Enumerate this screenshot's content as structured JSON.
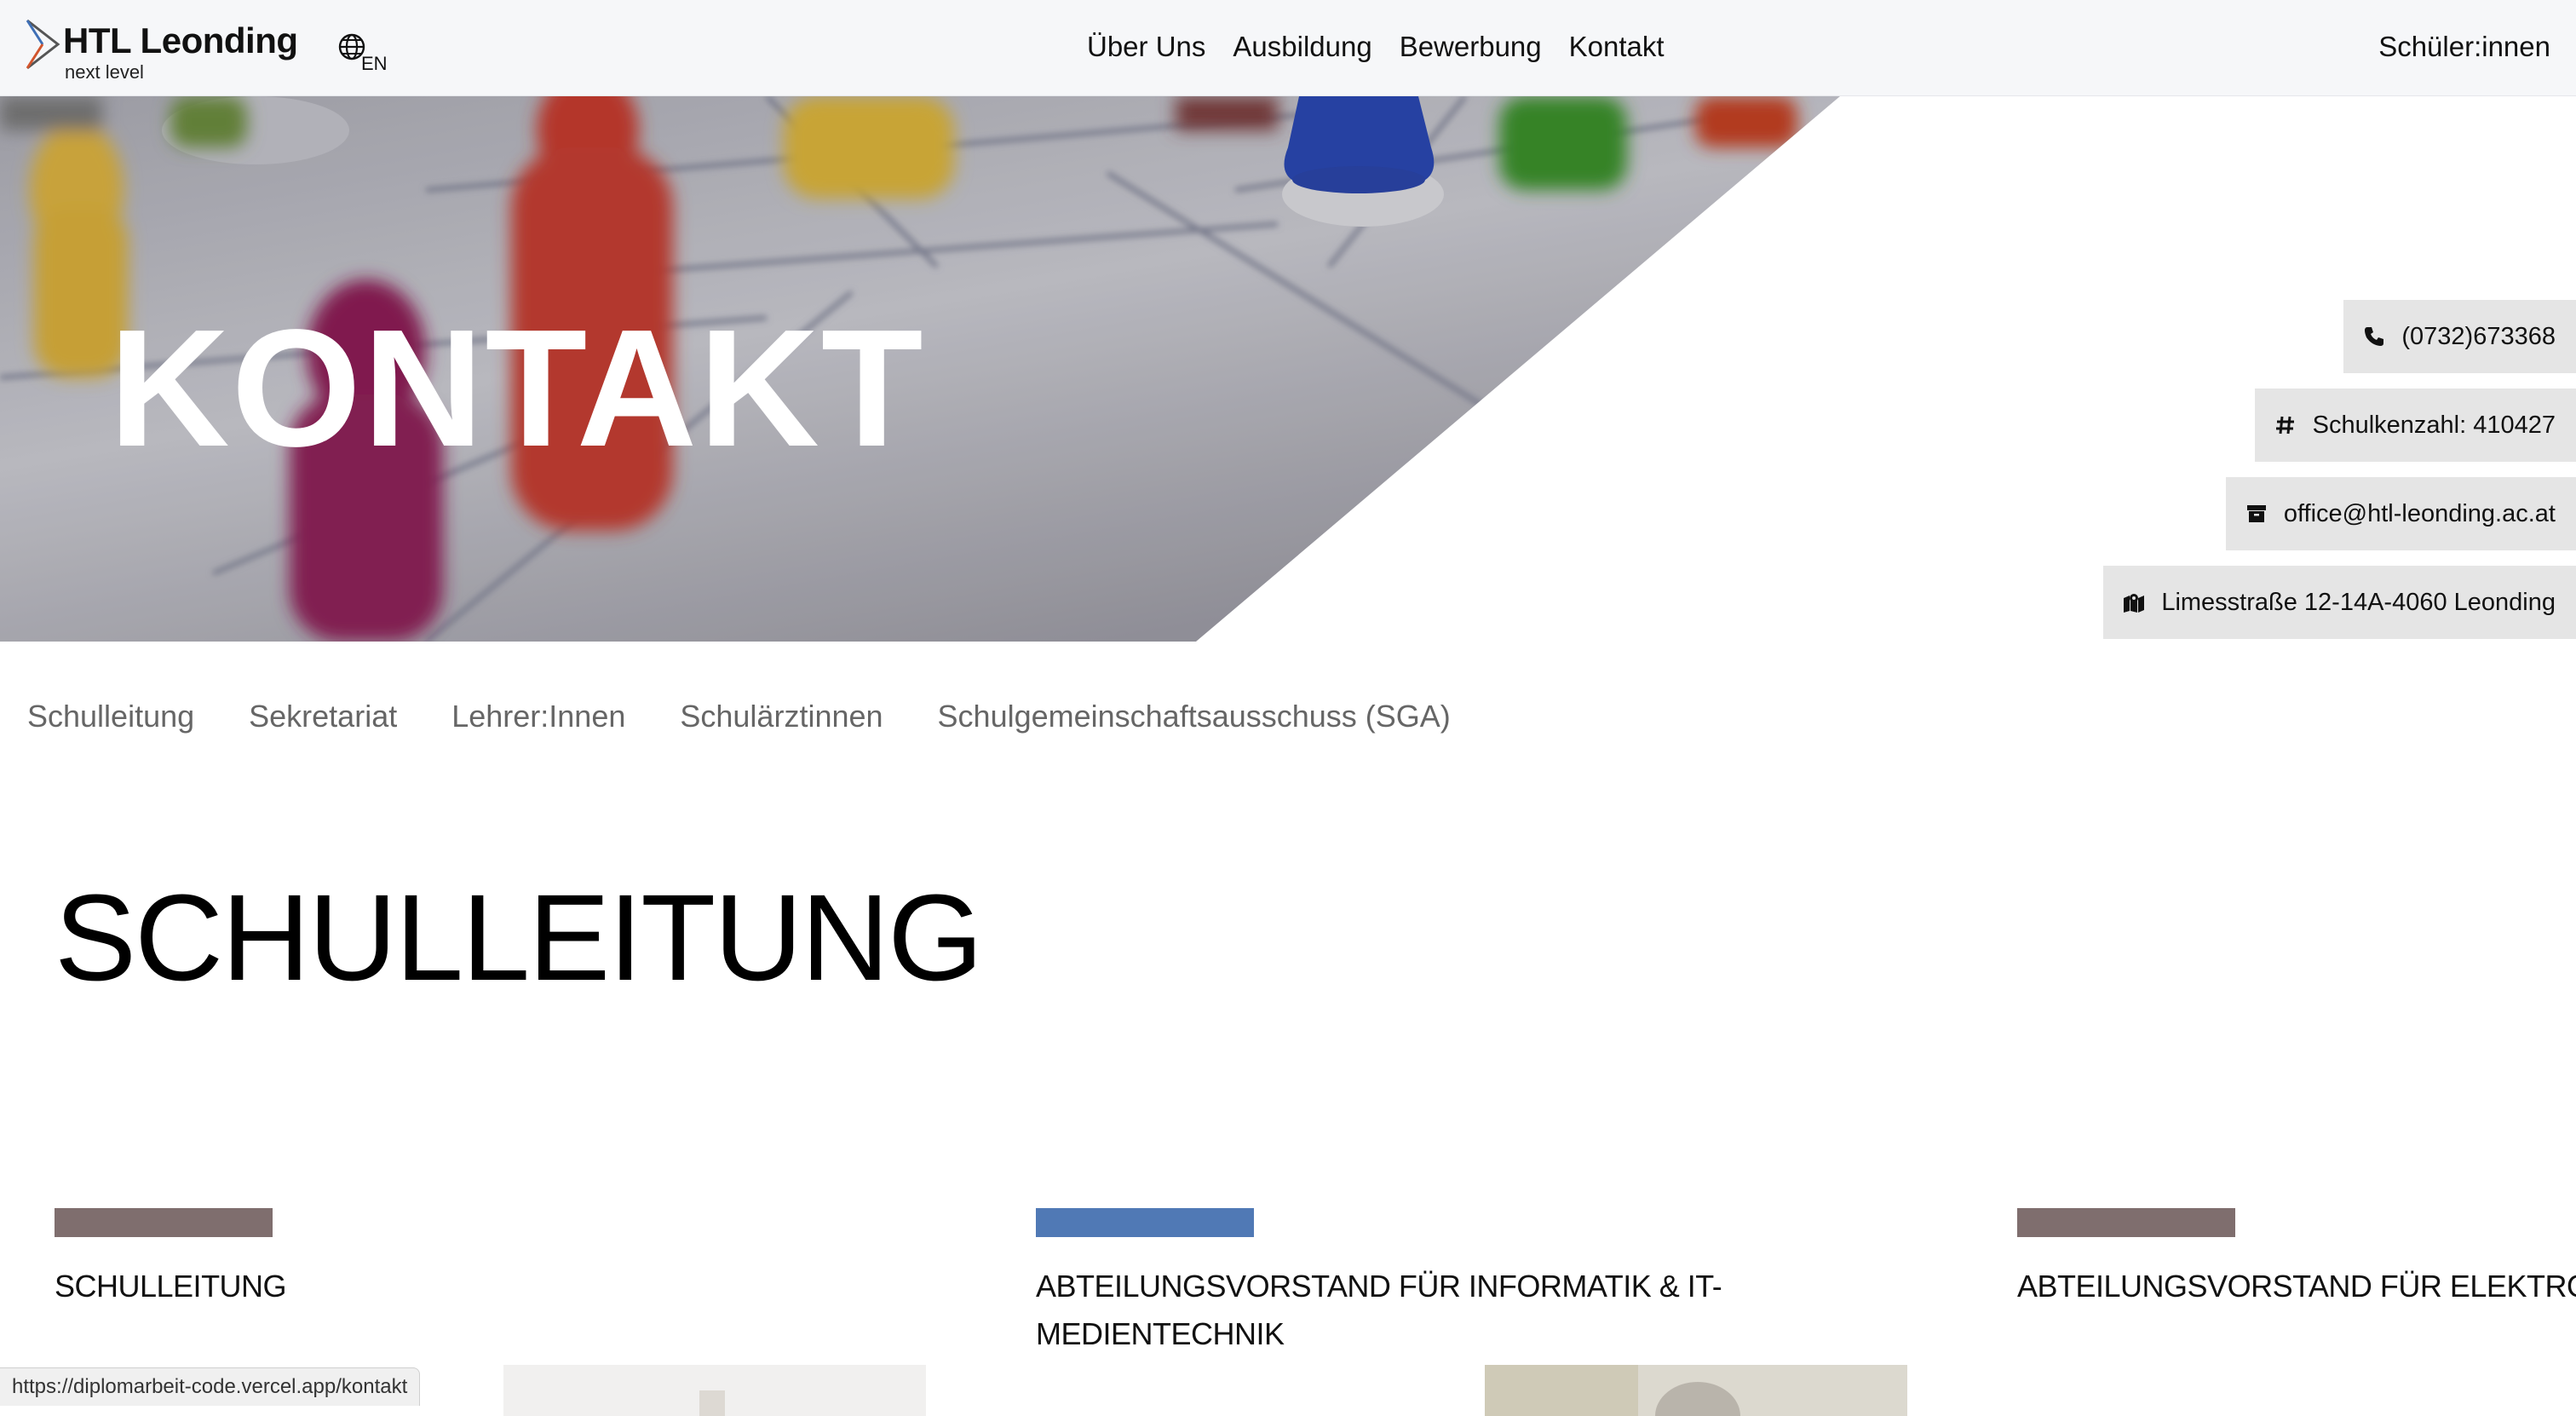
{
  "header": {
    "logo_title": "HTL Leonding",
    "logo_subtitle": "next level",
    "language_label": "EN",
    "nav": [
      "Über Uns",
      "Ausbildung",
      "Bewerbung",
      "Kontakt"
    ],
    "students_link": "Schüler:innen"
  },
  "hero": {
    "title": "KONTAKT"
  },
  "contact_chips": [
    {
      "icon": "phone-icon",
      "text": "(0732)673368"
    },
    {
      "icon": "hash-icon",
      "text": "Schulkenzahl: 410427"
    },
    {
      "icon": "archive-icon",
      "text": "office@htl-leonding.ac.at"
    },
    {
      "icon": "map-icon",
      "text": "Limesstraße 12-14A-4060 Leonding"
    }
  ],
  "subnav": [
    "Schulleitung",
    "Sekretariat",
    "Lehrer:Innen",
    "Schulärztinnen",
    "Schulgemeinschaftsausschuss (SGA)"
  ],
  "section": {
    "title": "SCHULLEITUNG"
  },
  "cards": [
    {
      "title": "SCHULLEITUNG",
      "color": "#7f6e6e"
    },
    {
      "title": "ABTEILUNGSVORSTAND FÜR INFORMATIK & IT-MEDIENTECHNIK",
      "color": "#5079b5"
    },
    {
      "title": "ABTEILUNGSVORSTAND FÜR ELEKTRONIK",
      "color": "#7f6e6e"
    }
  ],
  "status_url": "https://diplomarbeit-code.vercel.app/kontakt"
}
